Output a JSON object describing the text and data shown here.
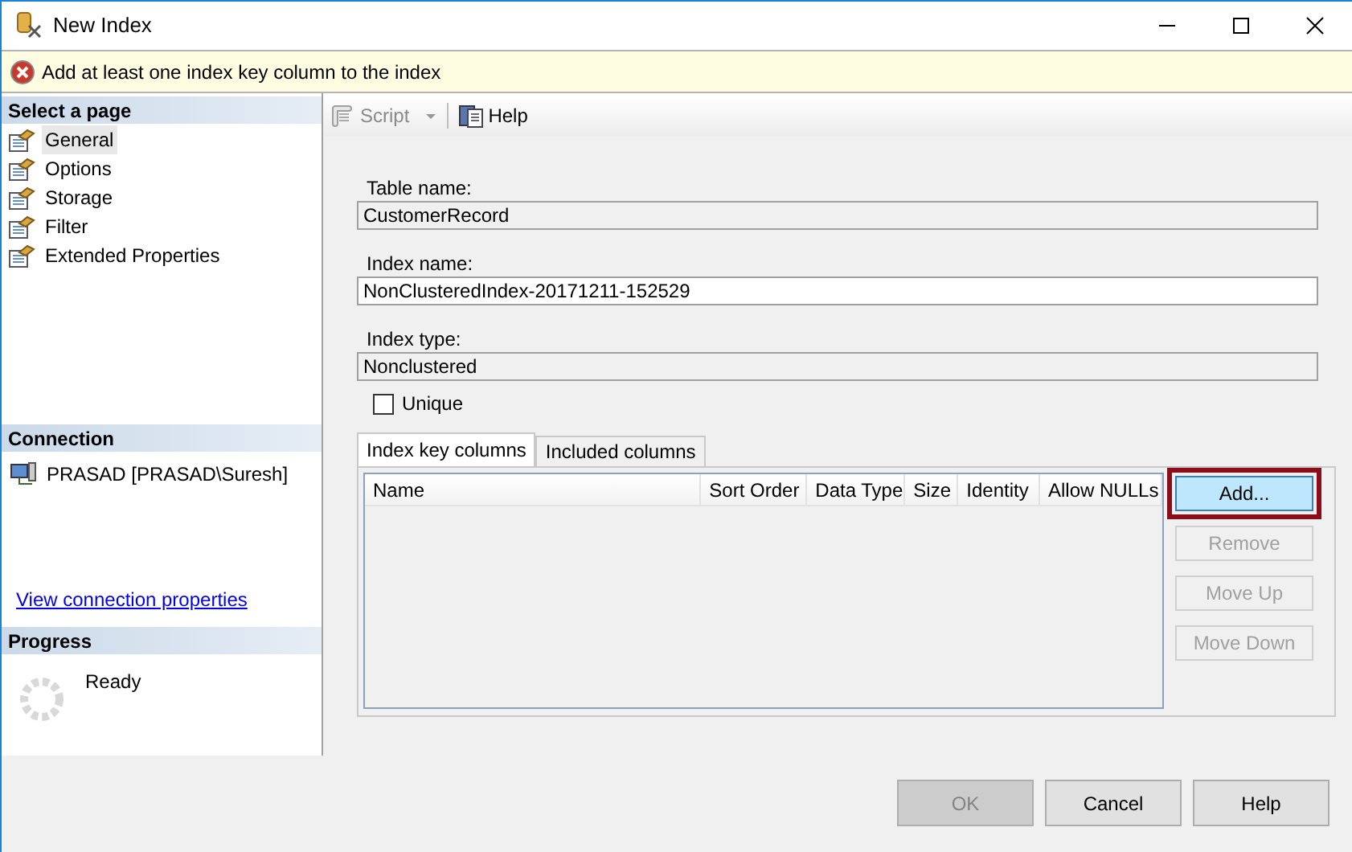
{
  "window": {
    "title": "New Index"
  },
  "message": {
    "text": "Add at least one index key column to the index"
  },
  "sidebar": {
    "header": "Select a page",
    "items": [
      {
        "label": "General",
        "selected": true
      },
      {
        "label": "Options",
        "selected": false
      },
      {
        "label": "Storage",
        "selected": false
      },
      {
        "label": "Filter",
        "selected": false
      },
      {
        "label": "Extended Properties",
        "selected": false
      }
    ]
  },
  "connection": {
    "header": "Connection",
    "server": "PRASAD [PRASAD\\Suresh]",
    "link": "View connection properties"
  },
  "progress": {
    "header": "Progress",
    "status": "Ready"
  },
  "toolbar": {
    "items": [
      {
        "kind": "script",
        "label": "Script",
        "disabled": true
      },
      {
        "kind": "help",
        "label": "Help",
        "disabled": false
      }
    ]
  },
  "fields": [
    {
      "label": "Table name:",
      "value": "CustomerRecord",
      "read_only": true
    },
    {
      "label": "Index name:",
      "value": "NonClusteredIndex-20171211-152529",
      "read_only": false
    },
    {
      "label": "Index type:",
      "value": "Nonclustered",
      "read_only": true
    }
  ],
  "unique": {
    "label": "Unique",
    "checked": false
  },
  "tabs": [
    {
      "label": "Index key columns",
      "selected": true
    },
    {
      "label": "Included columns",
      "selected": false
    }
  ],
  "table": {
    "columns": [
      "Name",
      "Sort Order",
      "Data Type",
      "Size",
      "Identity",
      "Allow NULLs"
    ]
  },
  "side_buttons": [
    {
      "label": "Add...",
      "disabled": false,
      "focused": true,
      "highlighted": true
    },
    {
      "label": "Remove",
      "disabled": true,
      "focused": false,
      "highlighted": false
    },
    {
      "label": "Move Up",
      "disabled": true,
      "focused": false,
      "highlighted": false
    },
    {
      "label": "Move Down",
      "disabled": true,
      "focused": false,
      "highlighted": false
    }
  ],
  "dialog_buttons": [
    {
      "label": "OK",
      "disabled": true
    },
    {
      "label": "Cancel",
      "disabled": false
    },
    {
      "label": "Help",
      "disabled": false
    }
  ]
}
